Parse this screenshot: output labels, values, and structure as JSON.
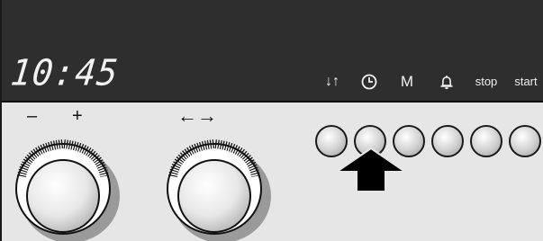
{
  "display": {
    "time": "10:45"
  },
  "function_buttons": [
    {
      "name": "fast-heat",
      "icon": "up-down-arrows-icon",
      "label": "↓↑"
    },
    {
      "name": "timer",
      "icon": "clock-icon",
      "label": ""
    },
    {
      "name": "memory",
      "icon": "",
      "label": "M"
    },
    {
      "name": "alarm",
      "icon": "bell-icon",
      "label": ""
    },
    {
      "name": "stop",
      "icon": "",
      "label": "stop"
    },
    {
      "name": "start",
      "icon": "",
      "label": "start"
    }
  ],
  "knobs": {
    "left_minus": "–",
    "left_plus": "+",
    "right_arrows": "←→"
  },
  "pointer": {
    "icon": "arrow-up-icon",
    "target": "timer"
  },
  "colors": {
    "display_bg": "#2e2e2e",
    "panel_bg": "#e6e6e6",
    "display_text": "#f2f2f2"
  }
}
